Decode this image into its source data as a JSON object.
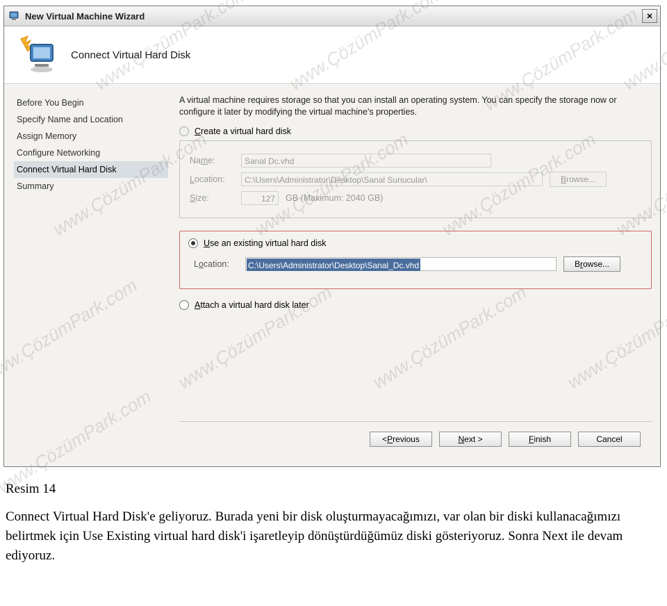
{
  "window": {
    "title": "New Virtual Machine Wizard",
    "close_glyph": "✕"
  },
  "header": {
    "title": "Connect Virtual Hard Disk"
  },
  "sidebar": {
    "steps": [
      "Before You Begin",
      "Specify Name and Location",
      "Assign Memory",
      "Configure Networking",
      "Connect Virtual Hard Disk",
      "Summary"
    ],
    "current_index": 4
  },
  "content": {
    "intro": "A virtual machine requires storage so that you can install an operating system. You can specify the storage now or configure it later by modifying the virtual machine's properties.",
    "option_create": {
      "label": "Create a virtual hard disk",
      "selected": false,
      "enabled": false,
      "name_label": "Name:",
      "name_value": "Sanal Dc.vhd",
      "location_label": "Location:",
      "location_value": "C:\\Users\\Administrator\\Desktop\\Sanal Sunucular\\",
      "browse_label": "Browse...",
      "size_label": "Size:",
      "size_value": "127",
      "size_suffix": "GB (Maximum: 2040 GB)"
    },
    "option_existing": {
      "label": "Use an existing virtual hard disk",
      "selected": true,
      "location_label": "Location:",
      "location_value": "C:\\Users\\Administrator\\Desktop\\Sanal_Dc.vhd",
      "browse_label": "Browse..."
    },
    "option_later": {
      "label": "Attach a virtual hard disk later",
      "selected": false
    }
  },
  "footer": {
    "previous": "< Previous",
    "next": "Next >",
    "finish": "Finish",
    "cancel": "Cancel"
  },
  "caption": {
    "title": "Resim 14",
    "body": "Connect Virtual Hard Disk'e geliyoruz. Burada yeni bir disk oluşturmayacağımızı, var olan bir diski kullanacağımızı belirtmek için Use Existing virtual hard disk'i işaretleyip dönüştürdüğümüz diski gösteriyoruz. Sonra Next ile devam ediyoruz."
  },
  "watermark_text": "www.ÇözümPark.com"
}
